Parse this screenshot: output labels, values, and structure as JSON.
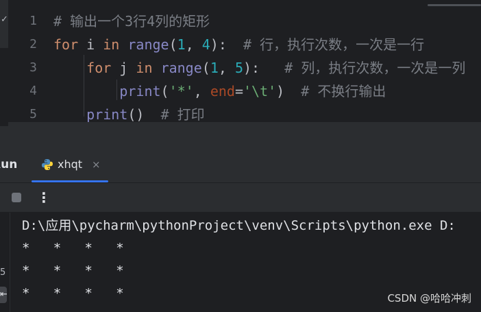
{
  "editor": {
    "line_numbers": [
      "1",
      "2",
      "3",
      "4",
      "5"
    ],
    "gutter_marker": "✓",
    "lines": [
      [
        {
          "cls": "cm",
          "text": "# 输出一个3行4列的矩形"
        }
      ],
      [
        {
          "cls": "kw",
          "text": "for"
        },
        {
          "cls": "plain",
          "text": " i "
        },
        {
          "cls": "kw",
          "text": "in"
        },
        {
          "cls": "plain",
          "text": " "
        },
        {
          "cls": "bi",
          "text": "range"
        },
        {
          "cls": "plain",
          "text": "("
        },
        {
          "cls": "num",
          "text": "1"
        },
        {
          "cls": "plain",
          "text": ", "
        },
        {
          "cls": "num",
          "text": "4"
        },
        {
          "cls": "plain",
          "text": "):  "
        },
        {
          "cls": "cm",
          "text": "# 行，执行次数，一次是一行"
        }
      ],
      [
        {
          "cls": "plain",
          "text": "    "
        },
        {
          "cls": "kw",
          "text": "for"
        },
        {
          "cls": "plain",
          "text": " j "
        },
        {
          "cls": "kw",
          "text": "in"
        },
        {
          "cls": "plain",
          "text": " "
        },
        {
          "cls": "bi",
          "text": "range"
        },
        {
          "cls": "plain",
          "text": "("
        },
        {
          "cls": "num",
          "text": "1"
        },
        {
          "cls": "plain",
          "text": ", "
        },
        {
          "cls": "num",
          "text": "5"
        },
        {
          "cls": "plain",
          "text": "):   "
        },
        {
          "cls": "cm",
          "text": "# 列，执行次数，一次是一列"
        }
      ],
      [
        {
          "cls": "plain",
          "text": "        "
        },
        {
          "cls": "bi",
          "text": "print"
        },
        {
          "cls": "plain",
          "text": "("
        },
        {
          "cls": "str",
          "text": "'*'"
        },
        {
          "cls": "plain",
          "text": ", "
        },
        {
          "cls": "kwarg",
          "text": "end"
        },
        {
          "cls": "plain",
          "text": "="
        },
        {
          "cls": "str",
          "text": "'\\t'"
        },
        {
          "cls": "plain",
          "text": ")  "
        },
        {
          "cls": "cm",
          "text": "# 不换行输出"
        }
      ],
      [
        {
          "cls": "plain",
          "text": "    "
        },
        {
          "cls": "bi",
          "text": "print"
        },
        {
          "cls": "plain",
          "text": "()  "
        },
        {
          "cls": "cm",
          "text": "# 打印"
        }
      ]
    ]
  },
  "run_window": {
    "title": "Run",
    "tab_label": "xhqt",
    "tab_close": "×",
    "more_glyph": "⋮",
    "left_strip_char": "5",
    "left_strip_btn": "⇤",
    "console_lines": [
      "D:\\应用\\pycharm\\pythonProject\\venv\\Scripts\\python.exe D:",
      "*   *   *   *",
      "*   *   *   *",
      "*   *   *   *"
    ]
  },
  "watermark": "CSDN @哈哈冲刺",
  "colors": {
    "background": "#1e1f22",
    "panel": "#2b2d30",
    "keyword": "#cf8e6d",
    "builtin": "#8888c6",
    "number": "#2aacb8",
    "string": "#6aab73",
    "comment": "#7a7e85",
    "kwarg": "#aa4926",
    "accent": "#3574f0"
  }
}
